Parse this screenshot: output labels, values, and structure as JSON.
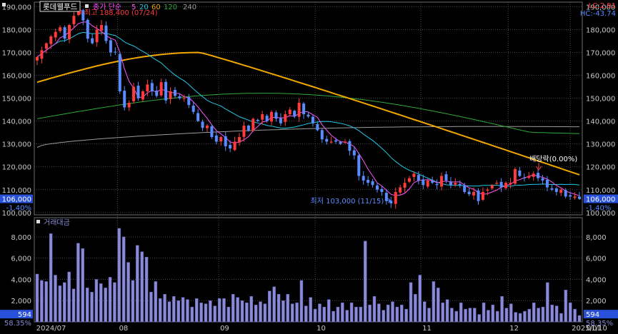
{
  "chart_data": [
    {
      "type": "candlestick",
      "title": "롯데웰푸드",
      "legend": {
        "label": "종가 단순",
        "items": [
          {
            "name": "5",
            "color": "#ff55ff"
          },
          {
            "name": "20",
            "color": "#22c8e6"
          },
          {
            "name": "60",
            "color": "#f0a800"
          },
          {
            "name": "120",
            "color": "#2fa83a"
          },
          {
            "name": "240",
            "color": "#9a9a9a"
          }
        ]
      },
      "x_ticks": [
        "2024/07",
        "08",
        "09",
        "10",
        "11",
        "12",
        "2025/01",
        "01/10"
      ],
      "y_ticks": [
        "190,000",
        "180,000",
        "170,000",
        "160,000",
        "150,000",
        "140,000",
        "130,000",
        "120,000",
        "110,000",
        "100,000"
      ],
      "ylim": [
        99000,
        192000
      ],
      "current_price": {
        "value": "106,000",
        "change": "-1.40%"
      },
      "indicators": {
        "lc": "LC:2.91",
        "hc": "HC:-43.74"
      },
      "annotations": {
        "high": "최고 188,400 (07/24)",
        "low": "최저 103,000 (11/15)",
        "dividend": "배당락(0.00%)"
      },
      "grid": true,
      "candle_colors": {
        "up": "#ff3c3c",
        "down": "#5a8cff"
      },
      "closes": [
        168000,
        171000,
        174000,
        177000,
        179000,
        181000,
        176000,
        182000,
        186000,
        188400,
        184000,
        176000,
        174000,
        180000,
        182000,
        175000,
        170000,
        170000,
        153000,
        146000,
        148000,
        155000,
        150000,
        153000,
        156000,
        153000,
        151000,
        157000,
        149000,
        153000,
        151000,
        150000,
        150000,
        147000,
        144000,
        140000,
        137000,
        138000,
        133000,
        131000,
        133000,
        129000,
        128000,
        131000,
        133000,
        138000,
        136000,
        141000,
        140000,
        143000,
        140000,
        144000,
        141000,
        139000,
        143000,
        145000,
        142000,
        148000,
        143000,
        142000,
        139000,
        136000,
        132000,
        131000,
        131000,
        131000,
        130000,
        131000,
        127000,
        125000,
        116000,
        114000,
        113000,
        112000,
        110000,
        109000,
        105000,
        104000,
        109000,
        111000,
        113000,
        115000,
        117000,
        114000,
        112000,
        114000,
        113000,
        112000,
        116000,
        114000,
        112000,
        113000,
        112000,
        109000,
        108000,
        109000,
        105000,
        109000,
        110000,
        112000,
        113000,
        111000,
        113000,
        113000,
        119000,
        116000,
        115000,
        116000,
        117000,
        115000,
        114000,
        111000,
        110000,
        109000,
        110000,
        107000,
        107000,
        107000,
        106000
      ]
    },
    {
      "type": "bar",
      "title": "거래대금",
      "y_ticks": [
        "8,000",
        "6,000",
        "4,000",
        "2,000"
      ],
      "ylim": [
        0,
        9000
      ],
      "current": {
        "value": "594",
        "ratio": "58.35%"
      },
      "values": [
        4500,
        3900,
        3800,
        8300,
        4400,
        3400,
        3700,
        4700,
        3100,
        7400,
        6900,
        3200,
        2800,
        4000,
        3600,
        3200,
        4200,
        3700,
        8800,
        8000,
        5600,
        3900,
        7200,
        6600,
        6100,
        2800,
        3800,
        2200,
        2600,
        1900,
        2400,
        2000,
        2300,
        2100,
        1400,
        2200,
        1800,
        1700,
        2000,
        1500,
        2200,
        2200,
        1400,
        2600,
        2300,
        2000,
        1800,
        2400,
        1600,
        1900,
        1700,
        2900,
        3300,
        2600,
        2000,
        2600,
        1700,
        1800,
        3900,
        1500,
        2300,
        1200,
        1700,
        1400,
        2100,
        1000,
        1400,
        1800,
        1100,
        1800,
        1400,
        1400,
        7600,
        1600,
        2400,
        1700,
        1100,
        1600,
        1900,
        1400,
        1600,
        1200,
        3700,
        2600,
        4400,
        1900,
        1300,
        3800,
        3200,
        1800,
        2100,
        1300,
        1000,
        1800,
        1200,
        1300,
        1300,
        700,
        1800,
        1100,
        1600,
        1000,
        2400,
        1300,
        1700,
        900,
        800,
        1000,
        1200,
        1800,
        1300,
        1400,
        3700,
        1600,
        1500,
        800,
        3000,
        1800,
        1200,
        600
      ]
    }
  ]
}
